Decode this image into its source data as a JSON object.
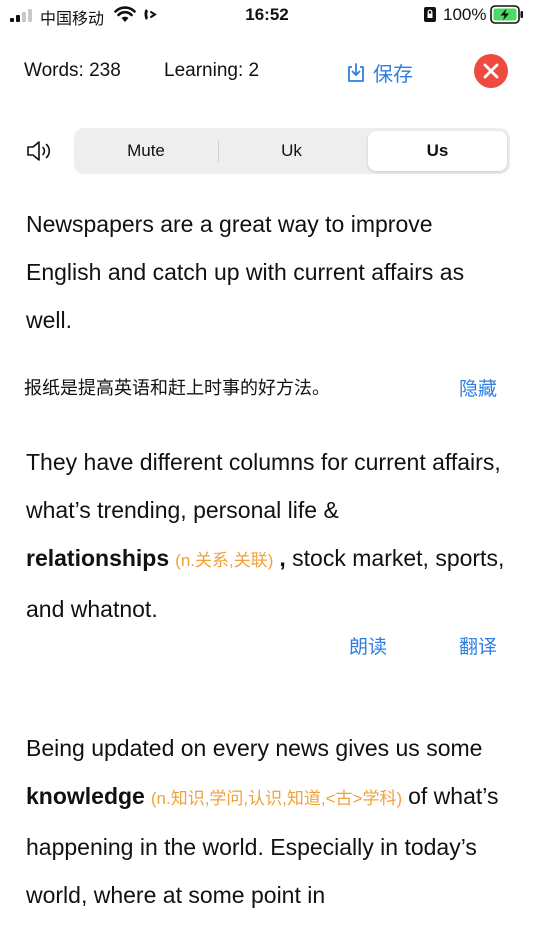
{
  "status_bar": {
    "carrier": "中国移动",
    "time": "16:52",
    "battery_percent": "100%"
  },
  "header": {
    "words_label": "Words: 238",
    "learning_label": "Learning: 2",
    "save_label": "保存"
  },
  "voice": {
    "options": [
      "Mute",
      "Uk",
      "Us"
    ],
    "selected": "Us"
  },
  "reading": {
    "para1": "Newspapers are a great way to improve English and catch up with current affairs as well.",
    "para1_translation": "报纸是提高英语和赶上时事的好方法。",
    "hide_label": "隐藏",
    "para2_before": "They have different columns for current affairs, what’s trending, personal life & ",
    "para2_word": "relationships",
    "para2_gloss": "(n.关系,关联)",
    "para2_after": ", stock market, sports, and whatnot.",
    "read_aloud_label": "朗读",
    "translate_label": "翻译",
    "para3_before": "Being updated on every news gives us some",
    "para3_word": "knowledge",
    "para3_gloss": "(n.知识,学问,认识,知道,<古>学科)",
    "para3_after": "of what’s happening in the world. Especially in today’s world, where at some point in"
  },
  "colors": {
    "accent": "#2f7ee3",
    "close": "#ed4b40",
    "gloss": "#f0a23a"
  }
}
